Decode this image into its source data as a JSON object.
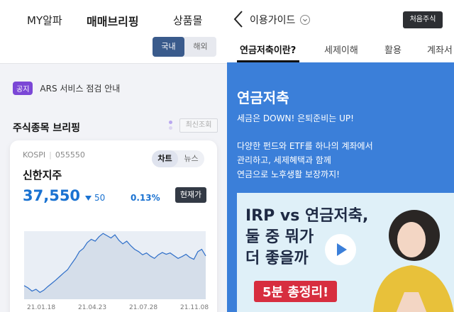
{
  "left": {
    "nav": {
      "items": [
        "MY알파",
        "매매브리핑",
        "상품몰"
      ],
      "active_index": 1
    },
    "market_toggle": {
      "domestic": "국내",
      "overseas": "해외",
      "selected": "국내"
    },
    "notice": {
      "tag": "공지",
      "text": "ARS 서비스 점검 안내"
    },
    "section": {
      "title": "주식종목 브리핑",
      "recent_button": "최신조회"
    },
    "stock": {
      "market": "KOSPI",
      "code": "055550",
      "name": "신한지주",
      "price": "37,550",
      "change": "50",
      "change_direction": "down",
      "change_pct": "0.13%",
      "current_price_button": "현재가",
      "tabs": [
        "차트",
        "뉴스"
      ],
      "active_tab": "차트"
    }
  },
  "right": {
    "header": {
      "title": "이용가이드",
      "first_visit_button": "처음주식"
    },
    "tabs": [
      "연금저축이란?",
      "세제이해",
      "활용",
      "계좌서"
    ],
    "active_tab": "연금저축이란?",
    "content": {
      "heading": "연금저축",
      "line1": "세금은 DOWN! 은퇴준비는 UP!",
      "para": [
        "다양한 펀드와 ETF를 하나의 계좌에서",
        "관리하고, 세제혜택과 함께",
        "연금으로 노후생활 보장까지!"
      ]
    },
    "video": {
      "lines": [
        "IRP vs 연금저축,",
        "둘 중 뭐가",
        "더 좋을까"
      ],
      "badge": "5분 총정리!"
    }
  },
  "colors": {
    "accent_blue": "#1a72d1",
    "panel_blue": "#3b7fd9",
    "toggle_on": "#3a5b8c",
    "notice_purple": "#7b47d6"
  },
  "chart_data": {
    "type": "area",
    "title": "",
    "x_ticks": [
      "21.01.18",
      "21.04.23",
      "21.07.28",
      "21.11.08"
    ],
    "y": [
      31000,
      30500,
      29800,
      30200,
      29500,
      30000,
      30800,
      31500,
      32200,
      33000,
      33800,
      34500,
      35800,
      37000,
      38500,
      39200,
      40500,
      41200,
      40800,
      41800,
      42500,
      42000,
      41500,
      42200,
      41000,
      40200,
      40800,
      39800,
      39000,
      38500,
      37800,
      38200,
      37500,
      37000,
      37800,
      38300,
      37900,
      38200,
      37600,
      37000,
      37400,
      37900,
      37200,
      36800,
      38500,
      39000,
      37550
    ],
    "ylim": [
      28000,
      43000
    ]
  }
}
